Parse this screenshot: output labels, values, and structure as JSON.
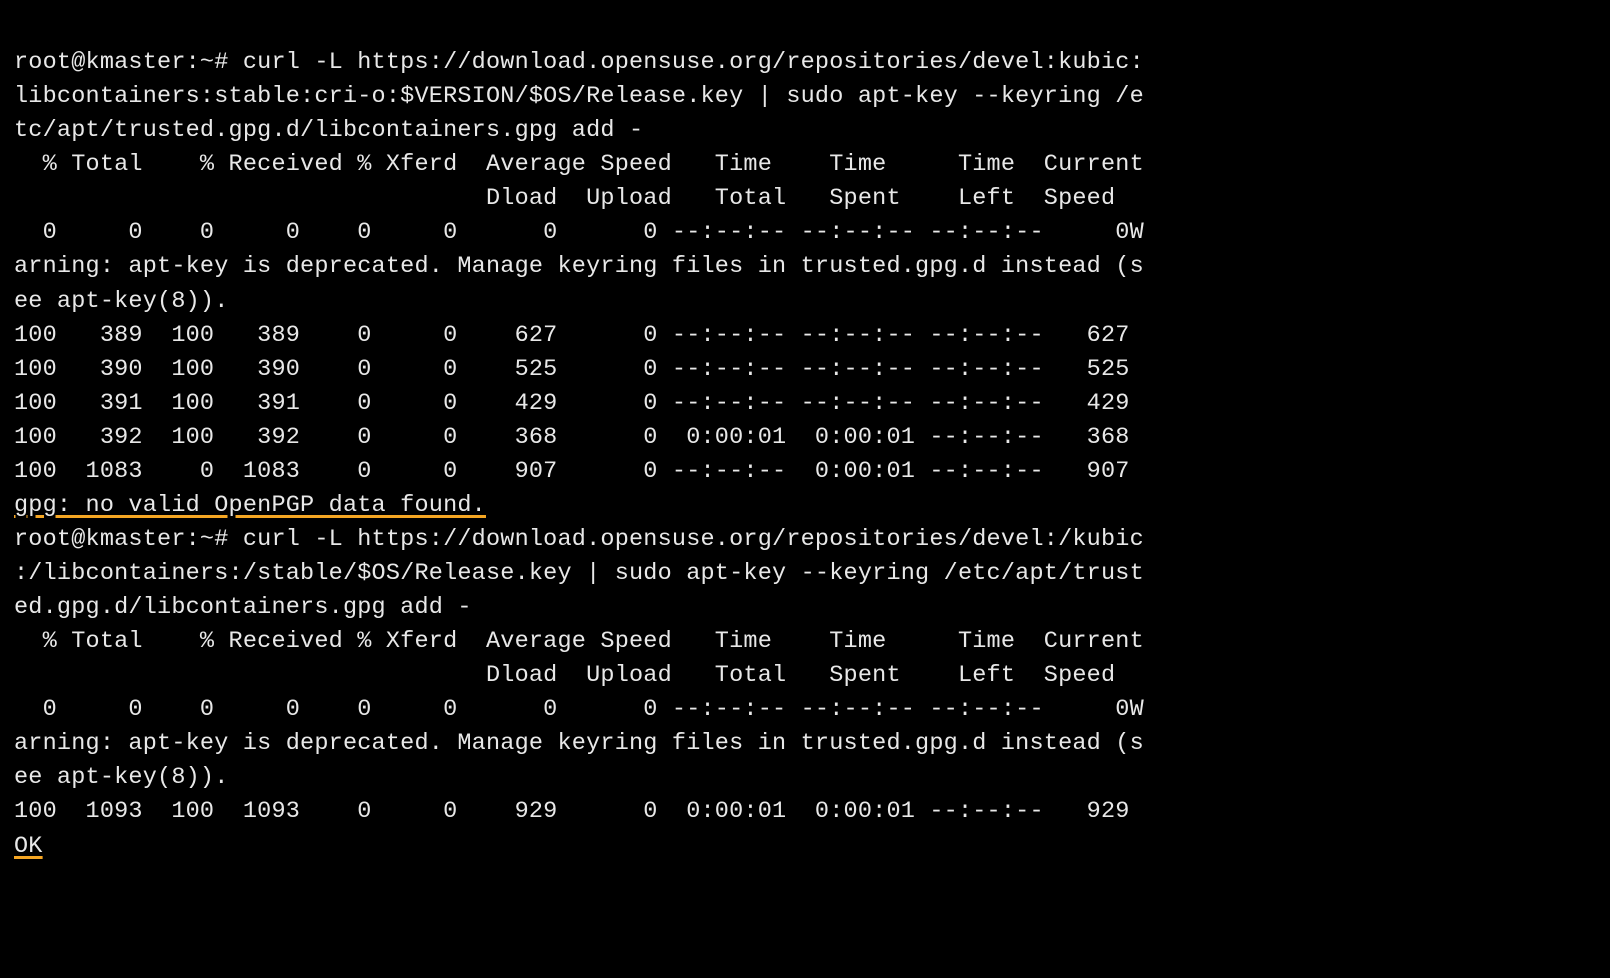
{
  "block1": {
    "prompt_line1": "root@kmaster:~# curl -L https://download.opensuse.org/repositories/devel:kubic:",
    "prompt_line2": "libcontainers:stable:cri-o:$VERSION/$OS/Release.key | sudo apt-key --keyring /e",
    "prompt_line3": "tc/apt/trusted.gpg.d/libcontainers.gpg add -",
    "header1": "  % Total    % Received % Xferd  Average Speed   Time    Time     Time  Current",
    "header2": "                                 Dload  Upload   Total   Spent    Left  Speed",
    "row0": "  0     0    0     0    0     0      0      0 --:--:-- --:--:-- --:--:--     0W",
    "warn1": "arning: apt-key is deprecated. Manage keyring files in trusted.gpg.d instead (s",
    "warn2": "ee apt-key(8)).",
    "row1": "100   389  100   389    0     0    627      0 --:--:-- --:--:-- --:--:--   627",
    "row2": "100   390  100   390    0     0    525      0 --:--:-- --:--:-- --:--:--   525",
    "row3": "100   391  100   391    0     0    429      0 --:--:-- --:--:-- --:--:--   429",
    "row4": "100   392  100   392    0     0    368      0  0:00:01  0:00:01 --:--:--   368",
    "row5": "100  1083    0  1083    0     0    907      0 --:--:--  0:00:01 --:--:--   907",
    "gpg_error": "gpg: no valid OpenPGP data found."
  },
  "block2": {
    "prompt_line1": "root@kmaster:~# curl -L https://download.opensuse.org/repositories/devel:/kubic",
    "prompt_line2": ":/libcontainers:/stable/$OS/Release.key | sudo apt-key --keyring /etc/apt/trust",
    "prompt_line3": "ed.gpg.d/libcontainers.gpg add -",
    "header1": "  % Total    % Received % Xferd  Average Speed   Time    Time     Time  Current",
    "header2": "                                 Dload  Upload   Total   Spent    Left  Speed",
    "row0": "  0     0    0     0    0     0      0      0 --:--:-- --:--:-- --:--:--     0W",
    "warn1": "arning: apt-key is deprecated. Manage keyring files in trusted.gpg.d instead (s",
    "warn2": "ee apt-key(8)).",
    "row1": "100  1093  100  1093    0     0    929      0  0:00:01  0:00:01 --:--:--   929",
    "ok": "OK"
  }
}
